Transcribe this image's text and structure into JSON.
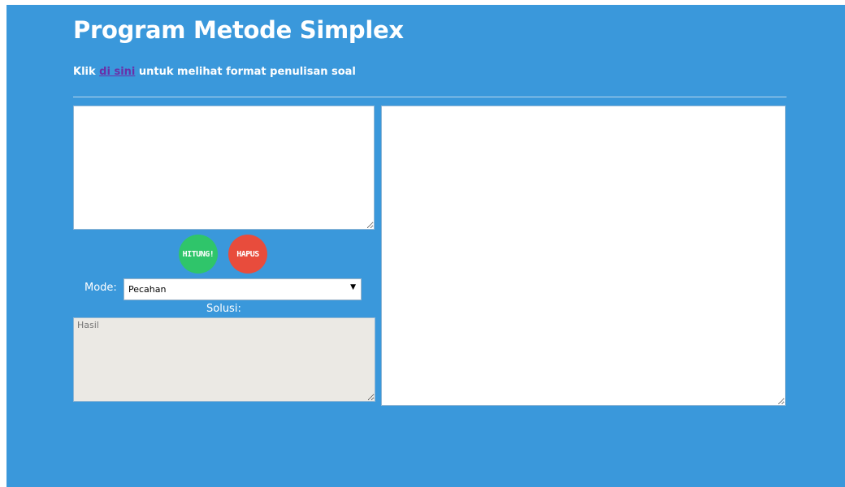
{
  "header": {
    "title": "Program Metode Simplex",
    "instruction_prefix": "Klik",
    "instruction_link": "di sini",
    "instruction_suffix": "untuk melihat format penulisan soal"
  },
  "input": {
    "value": "",
    "placeholder": ""
  },
  "buttons": {
    "hitung_label": "HITUNG!",
    "hapus_label": "HAPUS"
  },
  "mode": {
    "label": "Mode:",
    "selected": "Pecahan"
  },
  "solution": {
    "label": "Solusi:",
    "placeholder": "Hasil"
  },
  "output": {
    "value": ""
  },
  "colors": {
    "background": "#3a98db",
    "hitung": "#2fc56a",
    "hapus": "#e84c3c",
    "link": "#6a2fa8"
  }
}
